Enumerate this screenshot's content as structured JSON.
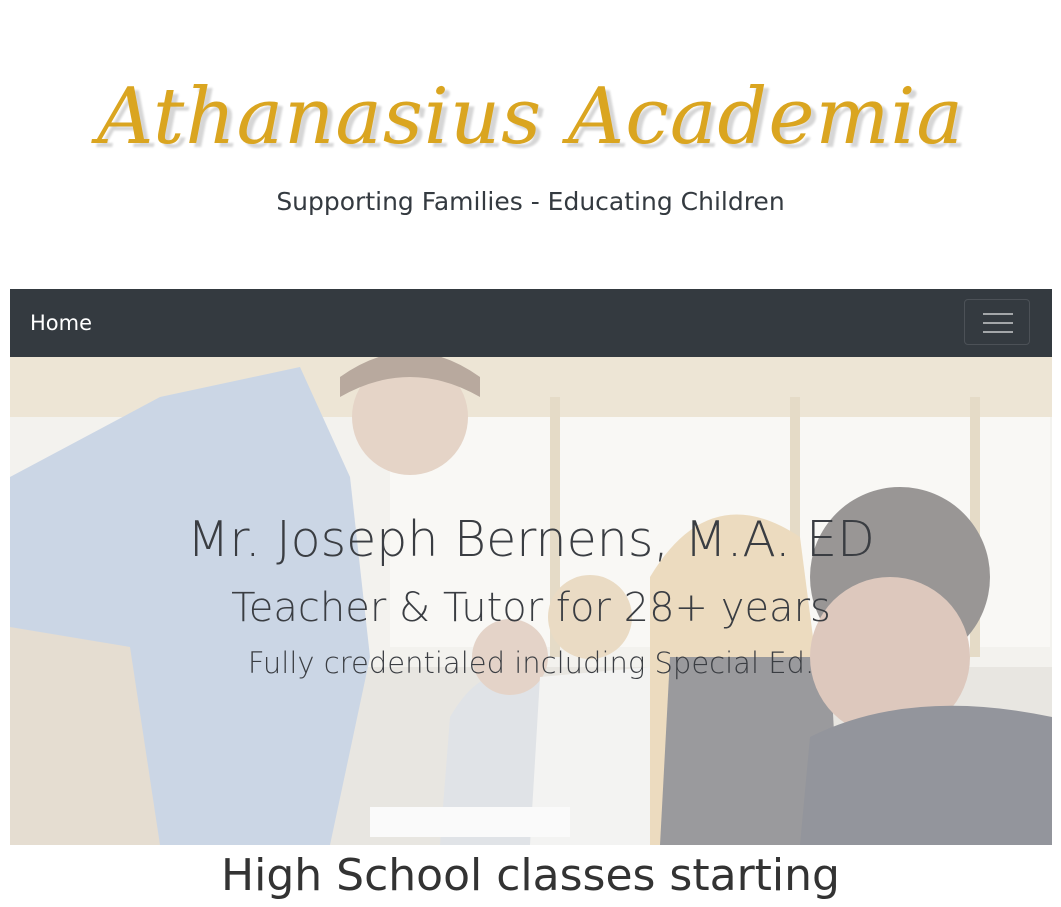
{
  "header": {
    "title": "Athanasius Academia",
    "tagline": "Supporting Families - Educating Children"
  },
  "navbar": {
    "home_label": "Home",
    "toggler_icon": "hamburger-menu-icon"
  },
  "hero": {
    "name": "Mr. Joseph Bernens, M.A. ED",
    "role": "Teacher & Tutor for 28+ years",
    "credentials": "Fully credentialed including Special Ed."
  },
  "main": {
    "announcement": "High School classes starting"
  },
  "colors": {
    "brand_gold": "#daa520",
    "navbar_bg": "#343a40",
    "text_dark": "#343a40"
  }
}
